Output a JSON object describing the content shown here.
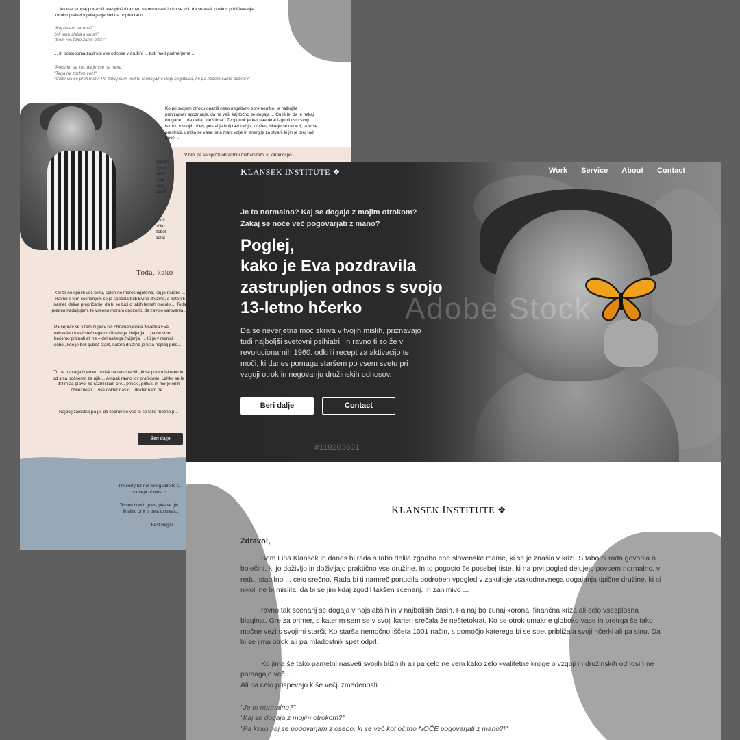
{
  "back": {
    "intro1": "... ko vse skupaj povzroči vsesplošni razpad samozavesti in ko se zdi, da se vsak poskus približevanja otroku prelevi v polaganje soli na odprto rano ...",
    "quotes1": [
      "\"Kaj delam narobe?\"",
      "\"Ali sem slaba mama?\"",
      "\"Sem res tako zanič oče?\""
    ],
    "intro2": "... in postopoma zastrupi vse odnose v družini ... tudi med partnerjema ...",
    "quotes2": [
      "\"Počutim se kot, da je vse na meni.\"",
      "\"Tega ne zdržim več!\"",
      "\"Čisto vsi so proti meni! Pa zakaj sem vedno ravno jaz v vlogi negativca, ko pa hočem samo dobro?!\""
    ],
    "right1": "Ko pri svojem otroku opaziš neko negativno spremembo, je najhujše pravzaprav spoznanje, da ne veš, kaj točno se dogaja ... Čutiš le, da je nekaj drugače ... da nekaj \"ne štima\". Tvoj otrok je kar naenkrat izgubil tisto svojo iskrico v svojih očeh, postal je bolj razdražljiv, otožen, hitreje se razjezi, laže se prestraši, umika se vase, ima manj volje in energije za stvari, ki jih je prej rad počel ...",
    "right2": "V tebi pa se sproži obrambni mehanizem, ki kar kriči po",
    "right2_frag": [
      "pojasn",
      "zgodi",
      "ignor",
      "\"pub",
      "kdaj",
      "ozadj"
    ],
    "right3_frag": [
      "konfl",
      "očitn",
      "zobol",
      "odlat"
    ],
    "heading": "Toda, kako",
    "body1": "Ker te ne spusti več blizu, sploh ne moreš ugotoviti, kaj je narobe ... Ravno s tem scenarijem se je soočala tudi Evina družina, o kateri ti nameč deliva prepričanje, da bi se tudi o takih temah moralo ... Toda preden nadaljujem, te vseeno moram opozoriti, da zavojo varovanja ...",
    "body2": "Pa čeprav se s tem ni prav nič obremenjevala 36-letna Eva, ... nekakšen ideal srečnega družinskega življenja ... pa če si to hočemo priznati ali ne – del našega življenja. ... Ki je v resnici seboj, kdo je bolj ljubeč starš, katera družina je tista najbolj prilo...",
    "body3": "To pa ustvarja izjemen pritisk na nas starših, ki se potem iskreno in od srca počnemo za njih ... Ampak ravno lov prafiktorje. Lahko se le držim za glavo, ko razmišljam o v... pritiski, pritiski in morje enih obveznosti ... vse dokler nas n... dokler nam ne...",
    "body4": "Najbolj žalostno pa je, da čeprav se vse to še tako močno p...",
    "btn": "Beri dalje",
    "footer1": "I'm sorry for not being able to s... concept of most c...",
    "footer2": "To see how it goes, please giv... finalist, or it is best to creat...",
    "footer3": "Best Regar..."
  },
  "nav": {
    "logo_first": "K",
    "logo_rest": "LANSEK",
    "logo_first2": "I",
    "logo_rest2": "NSTITUTE",
    "links": [
      "Work",
      "Service",
      "About",
      "Contact"
    ]
  },
  "hero": {
    "pre_line1": "Je to normalno? Kaj se dogaja z mojim otrokom?",
    "pre_line2": "Zakaj se noče več pogovarjati z mano?",
    "h1_line1": "Poglej,",
    "h1_line2": "kako je Eva pozdravila",
    "h1_line3": "zastrupljen odnos s svojo",
    "h1_line4": "13-letno hčerko",
    "lead": "Da se neverjetna moč skriva v tvojih mislih, priznavajo tudi najboljši svetovni psihiatri. In ravno ti so že v revolucionarnih 1960. odkrili recept za aktivacijo te moči, ki danes pomaga staršem po vsem svetu pri vzgoji otrok in negovanju družinskih odnosov.",
    "btn_primary": "Beri dalje",
    "btn_secondary": "Contact",
    "watermark": "Adobe Stock",
    "watermark_id": "#118263631"
  },
  "content": {
    "greeting": "Zdravo!,",
    "p1": "Sem Lina Klanšek in danes bi rada s tabo delila zgodbo ene slovenske mame, ki se je znašla v krizi. S tabo bi rada govorila o bolečini, ki jo doživljo in doživljajo praktično vse družine. In to pogosto še posebej tiste, ki na prvi pogled delujejo povsem normalno, v redu, stabilno ... celo srečno. Rada bi ti namreč ponudila podroben vpogled v zakulisje vsakodnevnega dogajanja tipične družine, ki si nikoli ne bi mislila, da bi se jim kdaj zgodil takšen scenarij. In zanimivo ...",
    "p2": "ravno tak scenarij se dogaja v najslabših in v najboljših časih. Pa naj bo zunaj korona, finančna kriza ali celo vsesplošna blaginja. Gre za primer, s katerim sem se v svoji karieri srečala že neštetokrat. Ko se otrok umakne globoko vase in pretrga še tako močne vezi s svojimi starši. Ko starša nemočno iščeta 1001 način, s pomočjo katerega bi se spet približala svoji hčerki ali pa sinu. Da bi se jima otrok ali pa mladostnik spet odprl.",
    "p3": "Ko jima še tako pametni nasveti svojih bližnjih ali pa celo ne vem kako zelo kvalitetne knjige o vzgoji in družinskih odnosih ne pomagajo več ...",
    "p3b": "Ali pa celo prispevajo k še večji zmedenosti ...",
    "quotes": [
      "\"Je to normalno?\"",
      "\"Kaj se dogaja z mojim otrokom?\"",
      "\"Pa kako naj se pogovarjam z osebo, ki se več kot očitno NOČE pogovarjati z mano?!\""
    ]
  }
}
